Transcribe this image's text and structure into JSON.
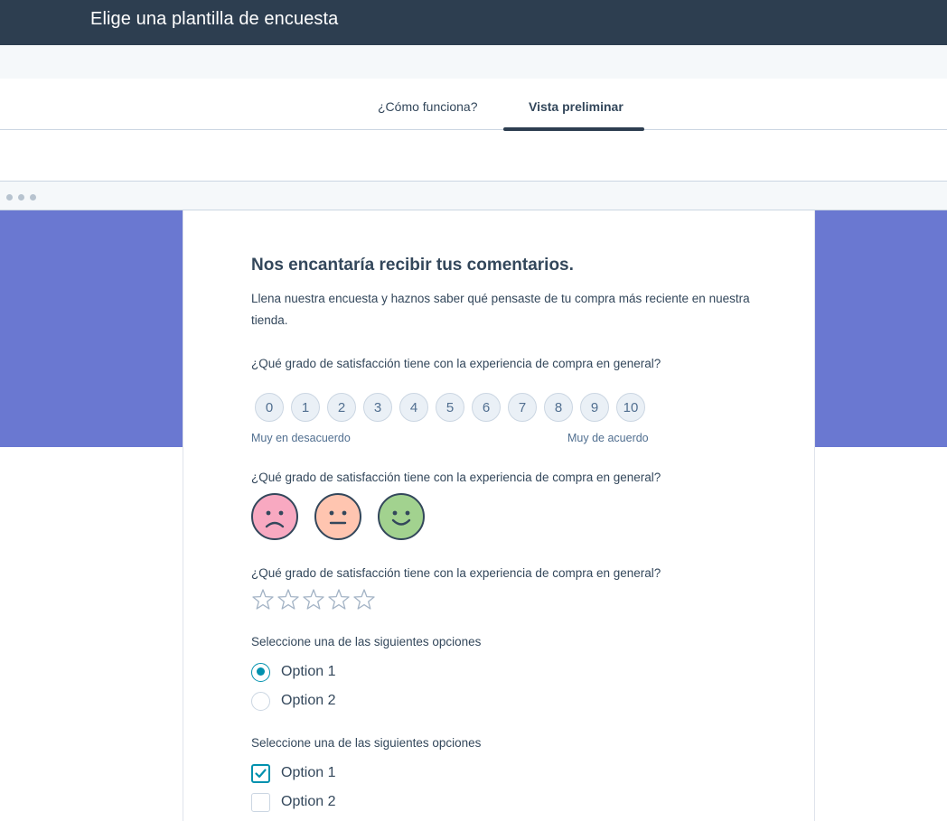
{
  "header": {
    "title": "Elige una plantilla de encuesta"
  },
  "tabs": [
    {
      "label": "¿Cómo funciona?",
      "active": false
    },
    {
      "label": "Vista preliminar",
      "active": true
    }
  ],
  "colors": {
    "header_bg": "#2d3e50",
    "accent_band": "#6a78d1",
    "teal_accent": "#0091ae",
    "face_sad": "#f8a9c1",
    "face_neutral": "#ffc5b0",
    "face_happy": "#a2d28f"
  },
  "form": {
    "title": "Nos encantaría recibir tus comentarios.",
    "description": "Llena nuestra encuesta y haznos saber qué pensaste de tu compra más reciente en nuestra tienda.",
    "q1": {
      "label": "¿Qué grado de satisfacción tiene con la experiencia de compra en general?",
      "scale": [
        "0",
        "1",
        "2",
        "3",
        "4",
        "5",
        "6",
        "7",
        "8",
        "9",
        "10"
      ],
      "low_label": "Muy en desacuerdo",
      "high_label": "Muy de acuerdo"
    },
    "q2": {
      "label": "¿Qué grado de satisfacción tiene con la experiencia de compra en general?",
      "faces": [
        "sad-face-icon",
        "neutral-face-icon",
        "happy-face-icon"
      ]
    },
    "q3": {
      "label": "¿Qué grado de satisfacción tiene con la experiencia de compra en general?",
      "stars_total": 5,
      "stars_selected": 0
    },
    "q4": {
      "label": "Seleccione una de las siguientes opciones",
      "options": [
        {
          "label": "Option 1",
          "checked": true
        },
        {
          "label": "Option 2",
          "checked": false
        }
      ]
    },
    "q5": {
      "label": "Seleccione una de las siguientes opciones",
      "options": [
        {
          "label": "Option 1",
          "checked": true
        },
        {
          "label": "Option 2",
          "checked": false
        }
      ]
    }
  }
}
